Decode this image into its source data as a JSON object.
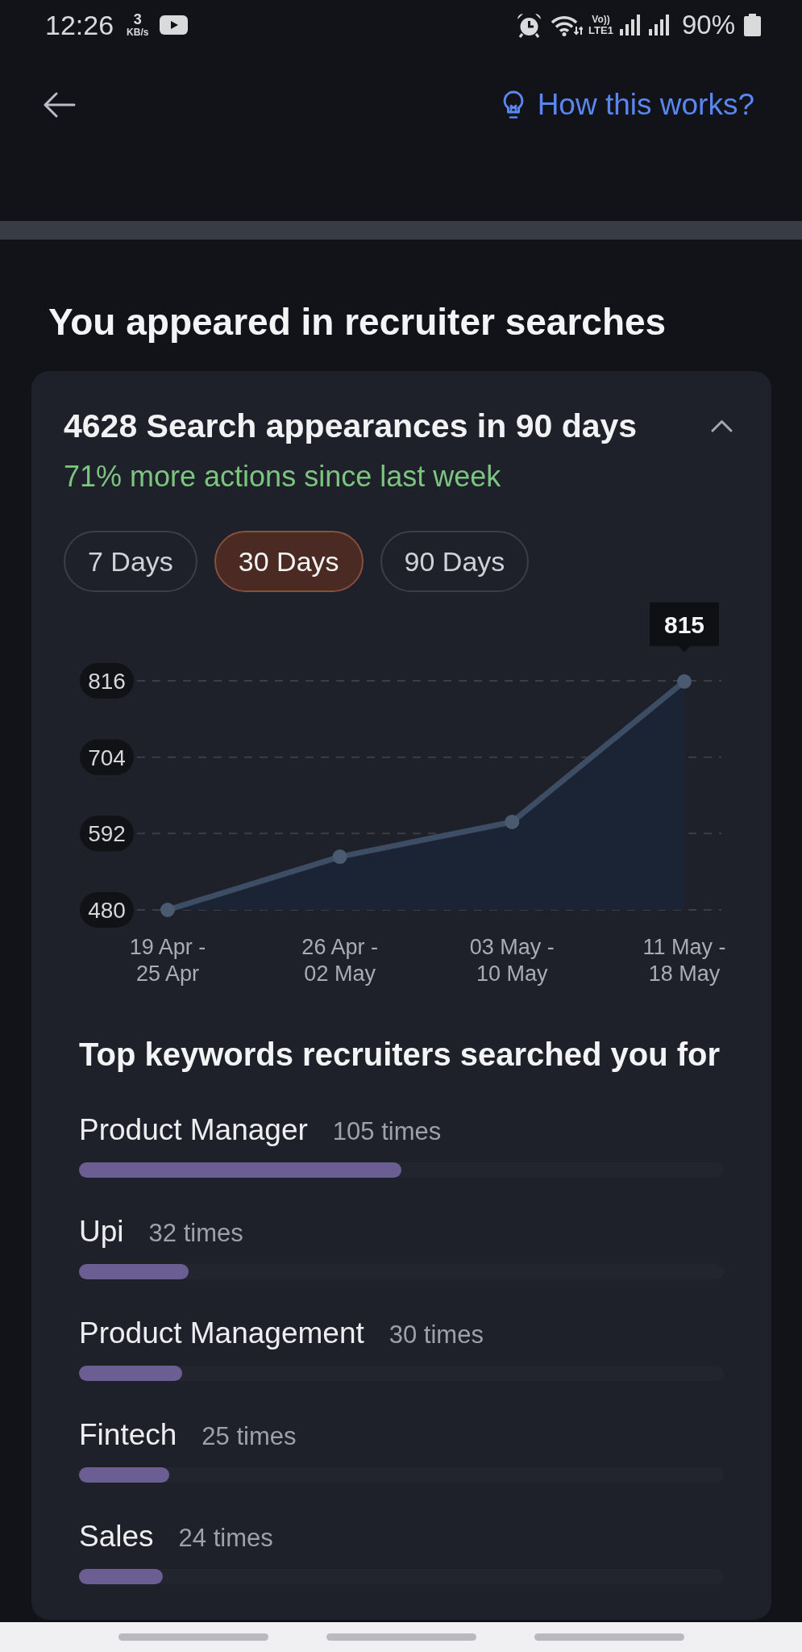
{
  "status_bar": {
    "time": "12:26",
    "speed": "3",
    "speed_unit": "KB/s",
    "network_top": "Vo))",
    "network_bottom": "LTE1",
    "battery": "90%"
  },
  "header": {
    "help_link": "How this works?"
  },
  "section": {
    "title": "You appeared in recruiter searches"
  },
  "card": {
    "title": "4628 Search appearances in 90 days",
    "expanded": true,
    "subtitle": "71% more actions since last week",
    "ranges": [
      {
        "label": "7 Days",
        "selected": false
      },
      {
        "label": "30 Days",
        "selected": true
      },
      {
        "label": "90 Days",
        "selected": false
      }
    ],
    "chart_data": {
      "type": "area",
      "categories": [
        "19 Apr -\n25 Apr",
        "26 Apr -\n02 May",
        "03 May -\n10 May",
        "11 May -\n18 May"
      ],
      "series": [
        {
          "color": "#3d4d64",
          "values": [
            480,
            558,
            609,
            815
          ]
        }
      ],
      "ylim": [
        480,
        816
      ],
      "yticks": [
        480,
        592,
        704,
        816
      ],
      "annotations": [
        {
          "x": "11 May -\n18 May",
          "y": 815,
          "text": "815"
        }
      ]
    },
    "keywords_title": "Top keywords recruiters searched you for",
    "keywords": [
      {
        "name": "Product Manager",
        "count": "105 times",
        "level": 0.5
      },
      {
        "name": "Upi",
        "count": "32 times",
        "level": 0.17
      },
      {
        "name": "Product Management",
        "count": "30 times",
        "level": 0.16
      },
      {
        "name": "Fintech",
        "count": "25 times",
        "level": 0.14
      },
      {
        "name": "Sales",
        "count": "24 times",
        "level": 0.13
      }
    ]
  }
}
